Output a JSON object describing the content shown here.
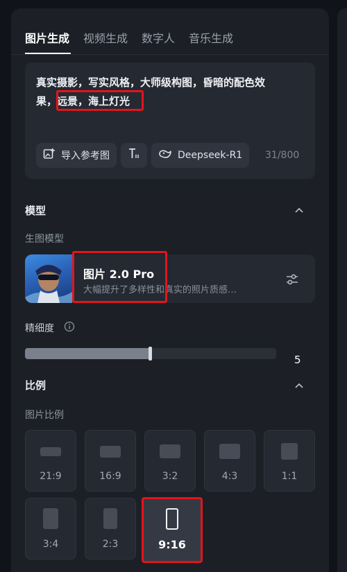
{
  "tabs": [
    {
      "label": "图片生成",
      "active": true
    },
    {
      "label": "视频生成",
      "active": false
    },
    {
      "label": "数字人",
      "active": false
    },
    {
      "label": "音乐生成",
      "active": false
    }
  ],
  "prompt": {
    "line1": "真实摄影，写实风格，大师级构图，昏暗的配色效",
    "line2": "果，远景，海上灯光",
    "import_ref_label": "导入参考图",
    "model_chip_label": "Deepseek-R1",
    "counter": "31/800"
  },
  "model_section": {
    "title": "模型",
    "sub_label": "生图模型",
    "model_name": "图片 2.0 Pro",
    "model_desc": "大幅提升了多样性和真实的照片质感…"
  },
  "precision": {
    "label": "精细度",
    "value": "5",
    "fill_fraction": 0.5
  },
  "ratio_section": {
    "title": "比例",
    "sub_label": "图片比例",
    "options": [
      "21:9",
      "16:9",
      "3:2",
      "4:3",
      "1:1",
      "3:4",
      "2:3",
      "9:16"
    ],
    "selected": "9:16"
  },
  "colors": {
    "highlight": "#e5141b",
    "panel": "#1c1f26",
    "card": "#252932"
  }
}
